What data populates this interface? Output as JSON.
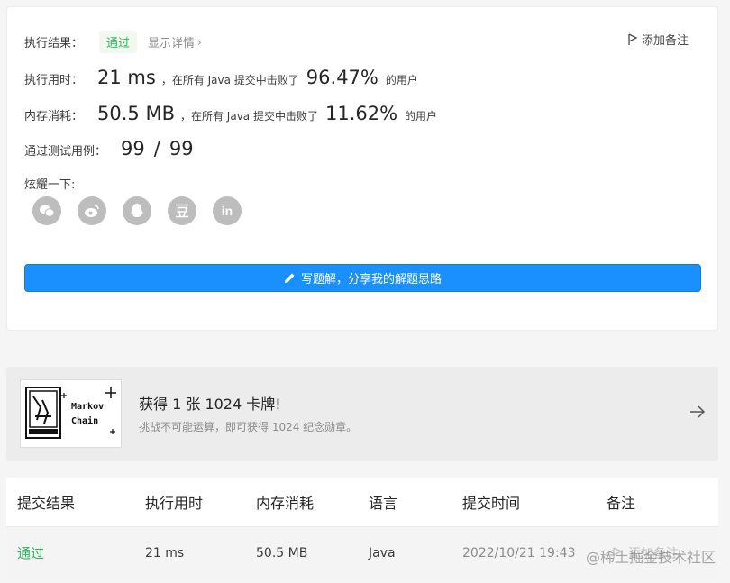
{
  "result": {
    "label": "执行结果：",
    "status": "通过",
    "details_link": "显示详情",
    "add_note": "添加备注"
  },
  "runtime": {
    "label": "执行用时：",
    "value": "21 ms",
    "mid": "，在所有 Java 提交中击败了",
    "percent": "96.47%",
    "tail": "的用户"
  },
  "memory": {
    "label": "内存消耗：",
    "value": "50.5 MB",
    "mid": "，在所有 Java 提交中击败了",
    "percent": "11.62%",
    "tail": "的用户"
  },
  "tests": {
    "label": "通过测试用例：",
    "passed": "99",
    "separator": "/",
    "total": "99"
  },
  "share": {
    "label": "炫耀一下:",
    "icons": [
      "wechat-icon",
      "weibo-icon",
      "qq-icon",
      "douban-icon",
      "linkedin-icon"
    ]
  },
  "solution_button": "写题解，分享我的解题思路",
  "promo": {
    "card_text_1": "Markov",
    "card_text_2": "Chain",
    "title": "获得 1 张 1024 卡牌!",
    "subtitle": "挑战不可能运算，即可获得 1024 纪念勋章。"
  },
  "table": {
    "headers": [
      "提交结果",
      "执行用时",
      "内存消耗",
      "语言",
      "提交时间",
      "备注"
    ],
    "row": {
      "result": "通过",
      "runtime": "21 ms",
      "memory": "50.5 MB",
      "language": "Java",
      "time": "2022/10/21 19:43",
      "note": "添加备注"
    }
  },
  "watermark": "@稀土掘金技术社区",
  "colors": {
    "accent": "#1a90ff",
    "success": "#2db55d"
  }
}
